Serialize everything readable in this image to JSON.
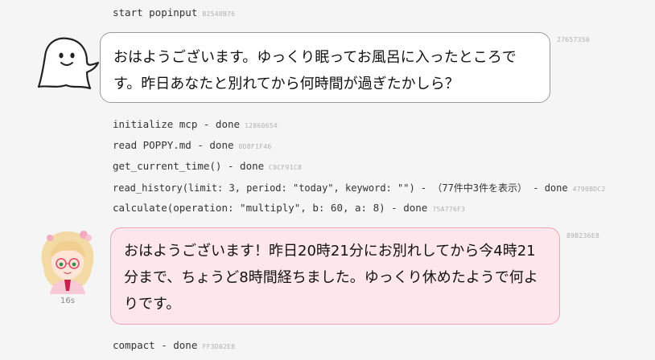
{
  "log_top": {
    "text": "start popinput",
    "tag": "B2540B76"
  },
  "ghost_message": {
    "text": "おはようございます。ゆっくり眠ってお風呂に入ったところです。昨日あなたと別れてから何時間が過ぎたかしら？",
    "tag": "27657350"
  },
  "tool_logs": [
    {
      "text": "initialize mcp  - done",
      "tag": "12860654"
    },
    {
      "text": "read POPPY.md  - done",
      "tag": "0D8F1F46"
    },
    {
      "text": "get_current_time()  - done",
      "tag": "C0CF91C8"
    },
    {
      "text": "read_history(limit: 3, period: \"today\", keyword: \"\") - （77件中3件を表示）  - done",
      "tag": "4790BDC2"
    },
    {
      "text": "calculate(operation: \"multiply\", b: 60, a: 8)  - done",
      "tag": "75A776F3"
    }
  ],
  "poppy_message": {
    "text": "おはようございます！昨日20時21分にお別れしてから今4時21分まで、ちょうど8時間経ちました。ゆっくり休めたようで何よりです。",
    "tag": "89B236E8",
    "elapsed": "16s"
  },
  "log_bottom": {
    "text": "compact  - done",
    "tag": "FF3D02E8"
  },
  "colors": {
    "background": "#f5f5f5",
    "poppy_bubble": "#fde7ec",
    "poppy_border": "#f2a2b4",
    "ghost_bubble": "#ffffff"
  },
  "icons": {
    "ghost": "ghost-avatar",
    "poppy": "poppy-avatar"
  }
}
